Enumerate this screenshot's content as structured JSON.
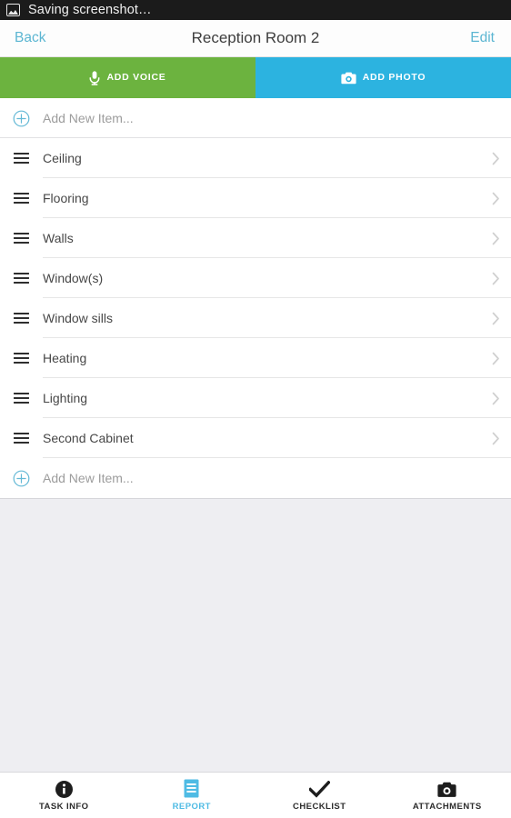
{
  "statusbar": {
    "icon": "screenshot-image-icon",
    "text": "Saving screenshot…"
  },
  "navbar": {
    "back_label": "Back",
    "title": "Reception Room 2",
    "edit_label": "Edit",
    "link_color": "#5cb6d2"
  },
  "actions": [
    {
      "id": "add-voice",
      "label": "ADD VOICE",
      "icon": "microphone-icon",
      "color": "#6cb33f"
    },
    {
      "id": "add-photo",
      "label": "ADD PHOTO",
      "icon": "camera-icon",
      "color": "#2cb3e0"
    }
  ],
  "list": {
    "add_new_top": {
      "label": "Add New Item...",
      "icon": "plus-circle-icon"
    },
    "add_new_bottom": {
      "label": "Add New Item...",
      "icon": "plus-circle-icon"
    },
    "items": [
      {
        "label": "Ceiling"
      },
      {
        "label": "Flooring"
      },
      {
        "label": "Walls"
      },
      {
        "label": "Window(s)"
      },
      {
        "label": "Window sills"
      },
      {
        "label": "Heating"
      },
      {
        "label": "Lighting"
      },
      {
        "label": "Second Cabinet"
      }
    ]
  },
  "tabbar": {
    "active_color": "#4fbbe4",
    "tabs": [
      {
        "id": "task-info",
        "label": "TASK INFO",
        "icon": "info-icon",
        "active": false
      },
      {
        "id": "report",
        "label": "REPORT",
        "icon": "document-icon",
        "active": true
      },
      {
        "id": "checklist",
        "label": "CHECKLIST",
        "icon": "checkmark-icon",
        "active": false
      },
      {
        "id": "attachments",
        "label": "ATTACHMENTS",
        "icon": "camera-icon",
        "active": false
      }
    ]
  }
}
